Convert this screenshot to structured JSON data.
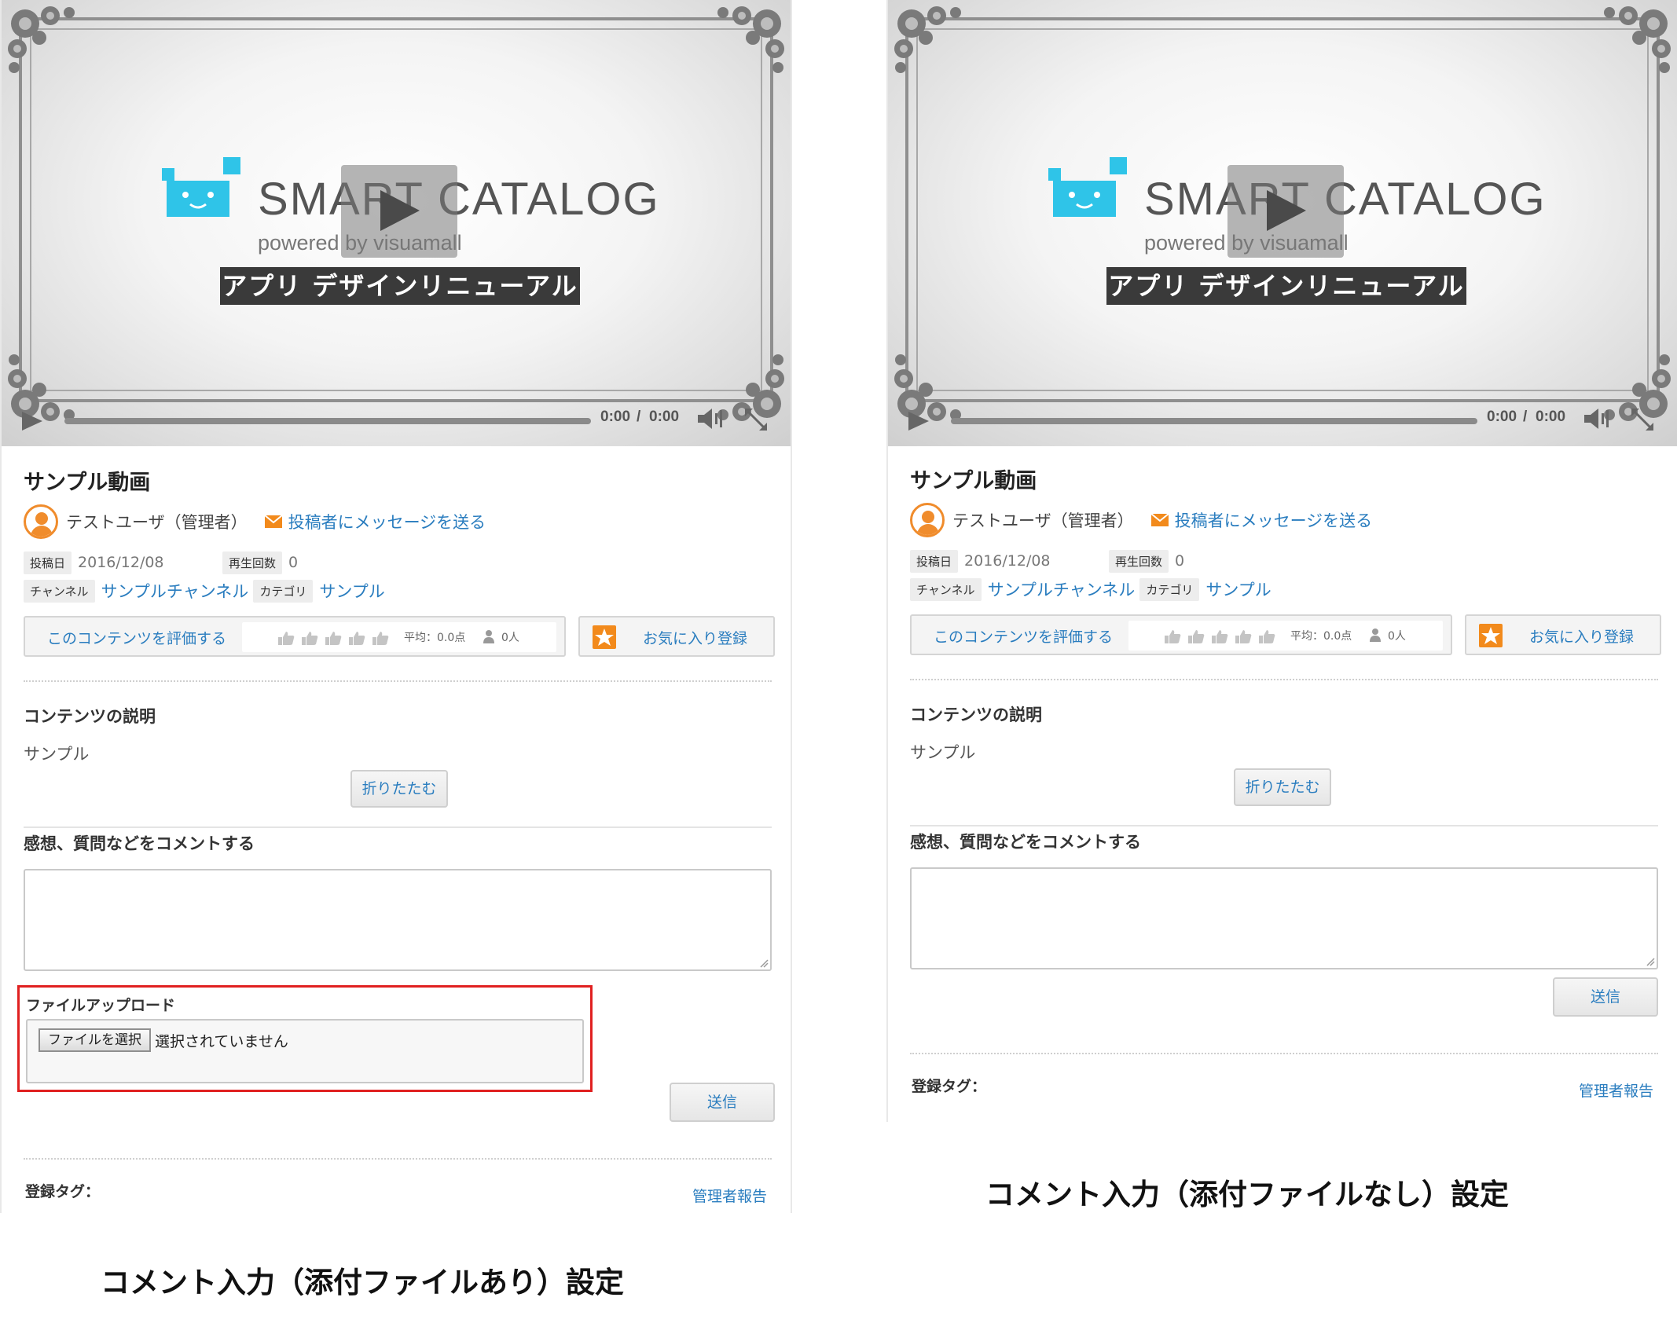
{
  "video": {
    "brand": "SMART CATALOG",
    "powered": "powered by visuamall",
    "banner": "アプリ デザインリニューアル",
    "time_current": "0:00",
    "time_sep": "/",
    "time_total": "0:00"
  },
  "content": {
    "title": "サンプル動画",
    "user_name": "テストユーザ（管理者）",
    "message_link": "投稿者にメッセージを送る",
    "posted_label": "投稿日",
    "posted_value": "2016/12/08",
    "plays_label": "再生回数",
    "plays_value": "0",
    "channel_label": "チャンネル",
    "channel_value": "サンプルチャンネル",
    "category_label": "カテゴリ",
    "category_value": "サンプル",
    "rate_label": "このコンテンツを評価する",
    "rating_average": "平均：0.0点",
    "rating_count": "0人",
    "favorite_label": "お気に入り登録",
    "description_heading": "コンテンツの説明",
    "description_text": "サンプル",
    "collapse_button": "折りたたむ",
    "comment_heading": "感想、質問などをコメントする",
    "upload_label": "ファイルアップロード",
    "choose_file_button": "ファイルを選択",
    "no_file_selected": "選択されていません",
    "send_button": "送信",
    "tags_label": "登録タグ：",
    "report_link": "管理者報告"
  },
  "captions": {
    "with_attachment": "コメント入力（添付ファイルあり）設定",
    "without_attachment": "コメント入力（添付ファイルなし）設定"
  },
  "colors": {
    "link": "#2a7dbf",
    "accent_orange": "#f28a1c",
    "highlight_red": "#e02020",
    "logo_cyan": "#2fc4e8"
  }
}
